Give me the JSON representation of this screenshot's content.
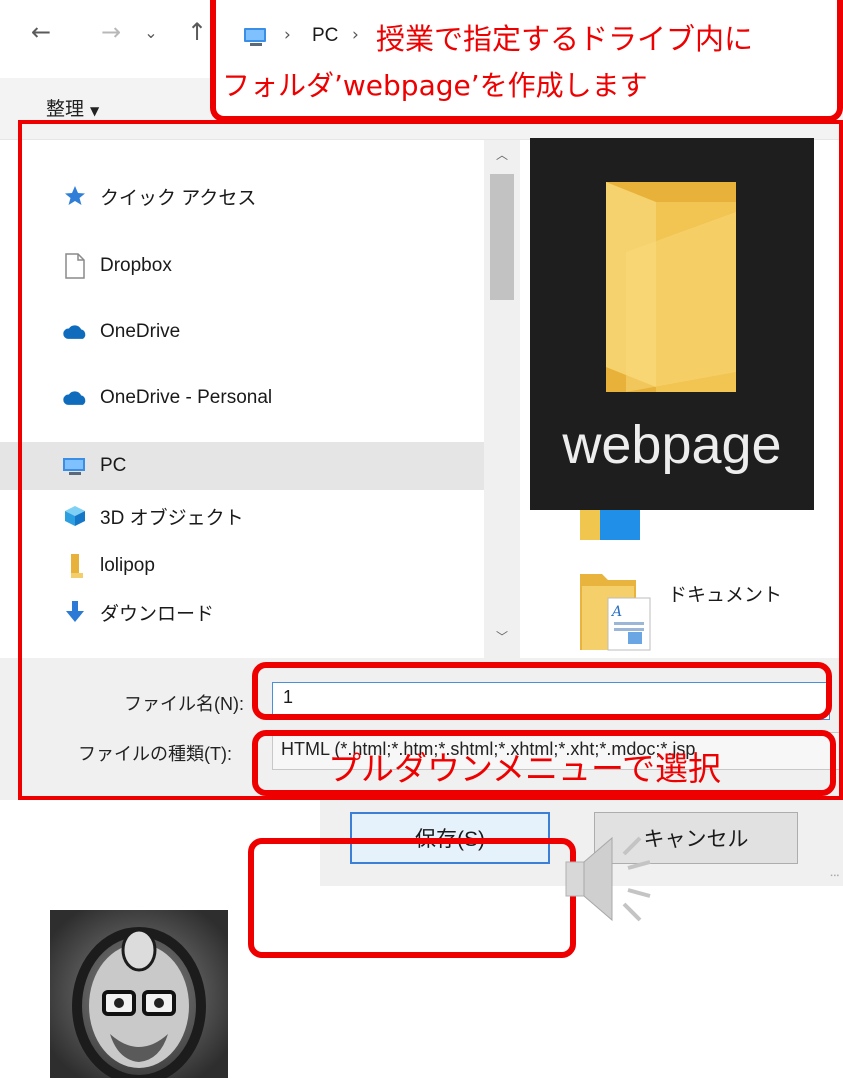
{
  "addressbar": {
    "path_segment": "PC"
  },
  "toolbar": {
    "organize_label": "整理"
  },
  "nav": {
    "items": [
      {
        "label": "クイック アクセス",
        "icon": "star-icon"
      },
      {
        "label": "Dropbox",
        "icon": "document-icon"
      },
      {
        "label": "OneDrive",
        "icon": "cloud-icon"
      },
      {
        "label": "OneDrive - Personal",
        "icon": "cloud-icon"
      },
      {
        "label": "PC",
        "icon": "computer-icon"
      },
      {
        "label": "3D オブジェクト",
        "icon": "cube-icon"
      },
      {
        "label": "lolipop",
        "icon": "folder-icon"
      },
      {
        "label": "ダウンロード",
        "icon": "download-arrow-icon"
      }
    ]
  },
  "content": {
    "items": [
      {
        "label": "ドキュメント",
        "icon": "documents-folder-icon"
      }
    ]
  },
  "overlay": {
    "folder_name": "webpage"
  },
  "form": {
    "filename_label": "ファイル名(N):",
    "filename_value": "1",
    "filetype_label": "ファイルの種類(T):",
    "filetype_value": "HTML (*.html;*.htm;*.shtml;*.xhtml;*.xht;*.mdoc;*.jsp"
  },
  "buttons": {
    "save_label": "保存(S)",
    "cancel_label": "キャンセル"
  },
  "annotations": {
    "path_note_line1": "授業で指定するドライブ内に",
    "path_note_line2": "フォルダ’webpage’を作成します",
    "filetype_note": "プルダウンメニューで選択",
    "color": "#ee0000"
  },
  "colors": {
    "accent": "#3c7fd6",
    "annotation": "#ee0000",
    "folder": "#f0c64f"
  }
}
